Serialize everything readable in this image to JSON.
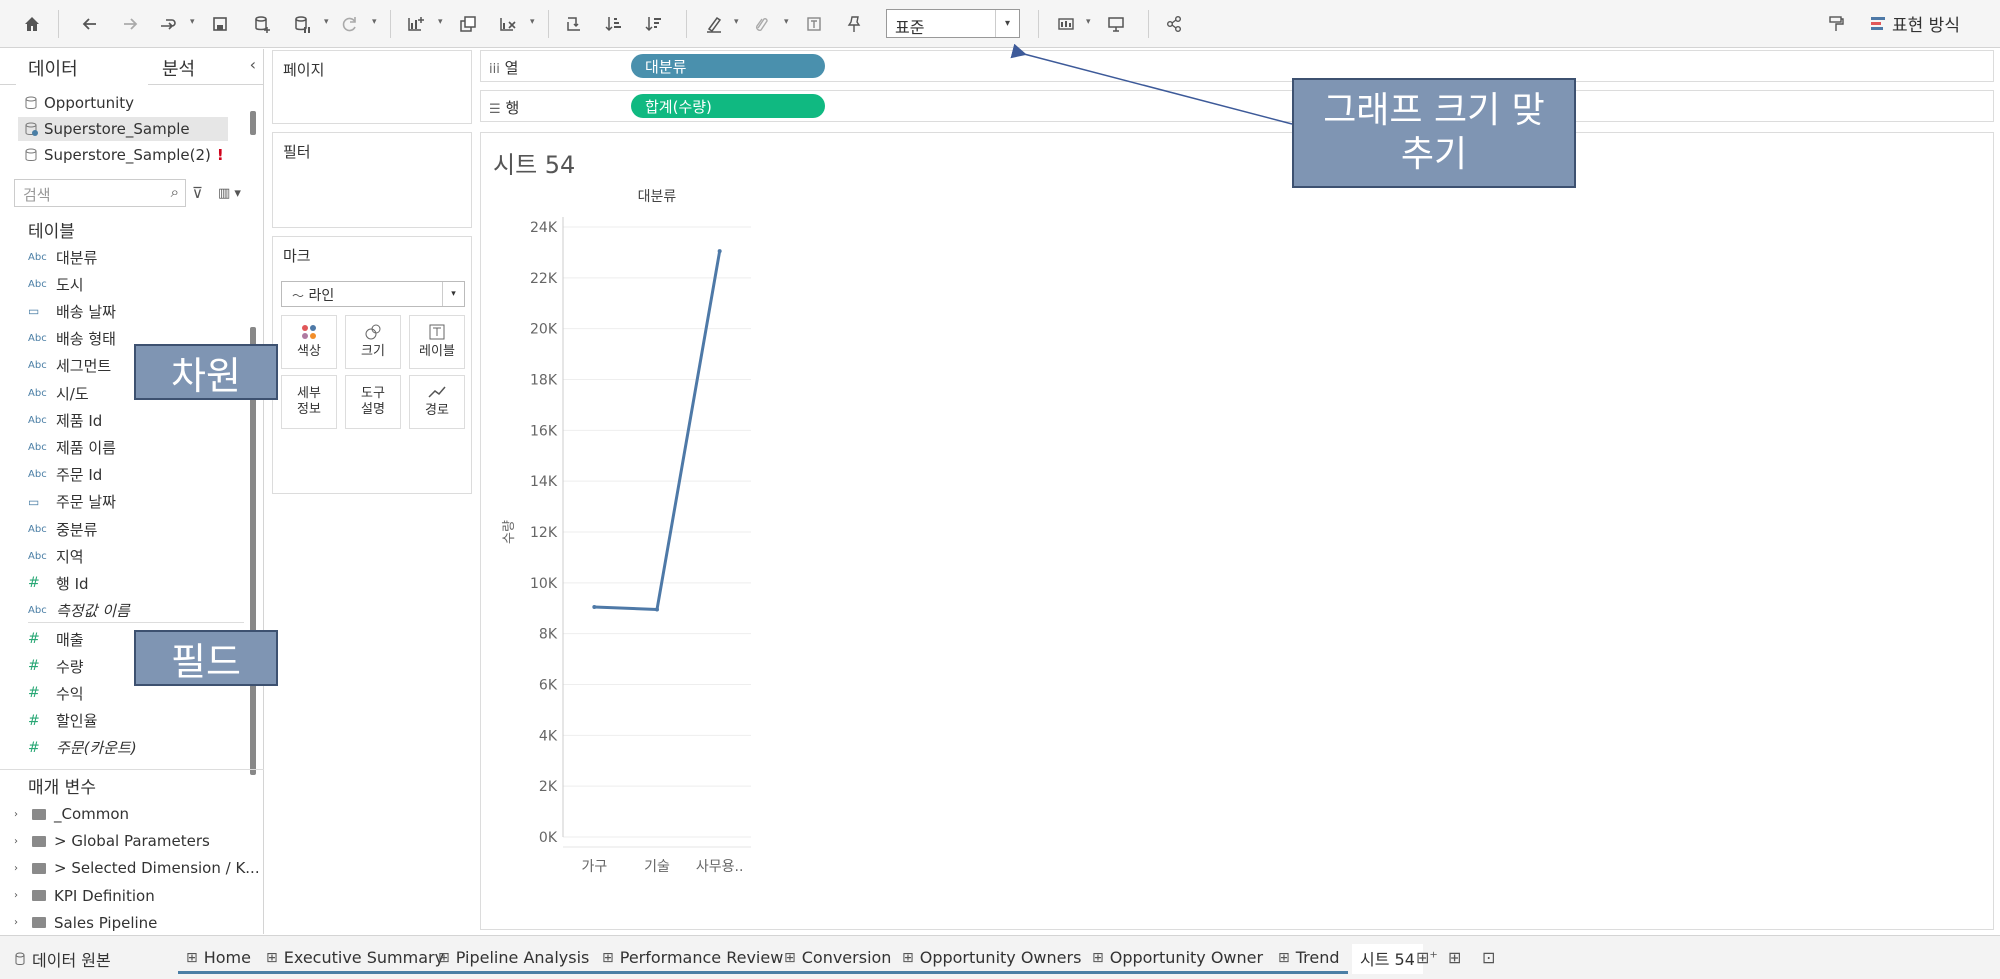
{
  "toolbar": {
    "fit_value": "표준",
    "show_me_label": "표현 방식"
  },
  "left_pane": {
    "tabs": [
      "데이터",
      "분석"
    ],
    "collapse_glyph": "‹",
    "datasources": [
      {
        "label": "Opportunity",
        "selected": false,
        "warn": ""
      },
      {
        "label": "Superstore_Sample",
        "selected": true,
        "warn": ""
      },
      {
        "label": "Superstore_Sample(2)",
        "selected": false,
        "warn": "!"
      }
    ],
    "search_placeholder": "검색",
    "tables_title": "테이블",
    "dimensions": [
      {
        "type": "Abc",
        "label": "대분류"
      },
      {
        "type": "Abc",
        "label": "도시"
      },
      {
        "type": "date",
        "label": "배송 날짜"
      },
      {
        "type": "Abc",
        "label": "배송 형태"
      },
      {
        "type": "Abc",
        "label": "세그먼트"
      },
      {
        "type": "Abc",
        "label": "시/도"
      },
      {
        "type": "Abc",
        "label": "제품 Id"
      },
      {
        "type": "Abc",
        "label": "제품 이름"
      },
      {
        "type": "Abc",
        "label": "주문 Id"
      },
      {
        "type": "date",
        "label": "주문 날짜"
      },
      {
        "type": "Abc",
        "label": "중분류"
      },
      {
        "type": "Abc",
        "label": "지역"
      },
      {
        "type": "#",
        "label": "행 Id"
      },
      {
        "type": "Abc",
        "label": "측정값 이름",
        "italic": true
      }
    ],
    "measures": [
      {
        "type": "#",
        "label": "매출"
      },
      {
        "type": "#",
        "label": "수량"
      },
      {
        "type": "#",
        "label": "수익"
      },
      {
        "type": "#",
        "label": "할인율"
      },
      {
        "type": "#",
        "label": "주문(카운트)",
        "italic": true
      }
    ],
    "params_title": "매개 변수",
    "folders": [
      "_Common",
      "> Global Parameters",
      "> Selected Dimension / K...",
      "KPI Definition",
      "Sales Pipeline"
    ]
  },
  "cards": {
    "pages_title": "페이지",
    "filters_title": "필터",
    "marks_title": "마크",
    "mark_type": "라인",
    "mark_buttons": [
      {
        "label": "색상",
        "icon": "color-dots-icon"
      },
      {
        "label": "크기",
        "icon": "size-icon"
      },
      {
        "label": "레이블",
        "icon": "label-icon"
      },
      {
        "label": "세부\n정보",
        "icon": "detail-icon"
      },
      {
        "label": "도구\n설명",
        "icon": "tooltip-icon"
      },
      {
        "label": "경로",
        "icon": "path-icon"
      }
    ]
  },
  "shelves": {
    "columns_label": "열",
    "columns_pill": "대분류",
    "rows_label": "행",
    "rows_pill": "합계(수량)",
    "columns_color": "#4a90ad",
    "rows_color": "#10b981"
  },
  "sheet": {
    "title": "시트 54"
  },
  "chart_data": {
    "type": "line",
    "title": "",
    "header": "대분류",
    "categories": [
      "가구",
      "기술",
      "사무용.."
    ],
    "values": [
      9050,
      8950,
      23050
    ],
    "ylabel": "수량",
    "xlabel": "",
    "ylim": [
      0,
      24000
    ],
    "yticks": [
      "0K",
      "2K",
      "4K",
      "6K",
      "8K",
      "10K",
      "12K",
      "14K",
      "16K",
      "18K",
      "20K",
      "22K",
      "24K"
    ],
    "line_color": "#4e79a7",
    "grid": true
  },
  "annotations": {
    "fit_callout": "그래프 크기 맞\n추기",
    "dimension_callout": "차원",
    "measure_callout": "필드"
  },
  "bottom_tabs": {
    "datasource_label": "데이터 원본",
    "tabs": [
      "Home",
      "Executive Summary",
      "Pipeline Analysis",
      "Performance Review",
      "Conversion",
      "Opportunity Owners",
      "Opportunity Owner",
      "Trend",
      "시트 54"
    ],
    "active": "시트 54"
  }
}
